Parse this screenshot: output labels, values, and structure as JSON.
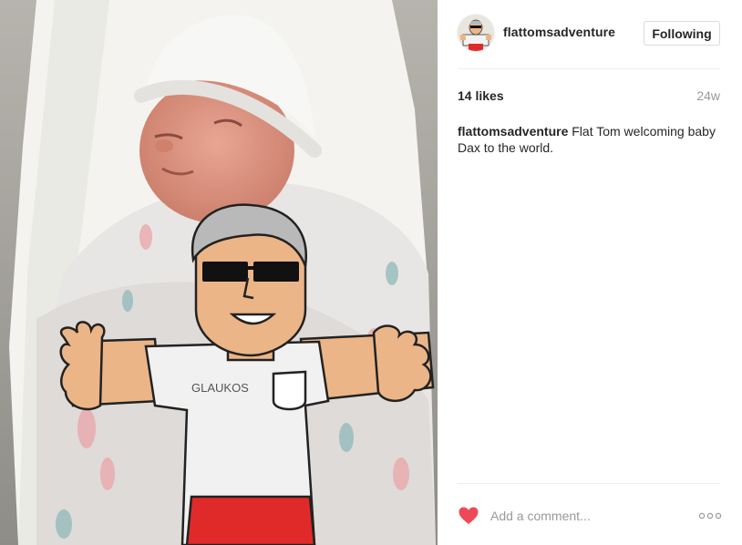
{
  "post": {
    "username": "flattomsadventure",
    "follow_label": "Following",
    "likes": "14 likes",
    "time_ago": "24w",
    "caption_user": "flattomsadventure",
    "caption_text": " Flat Tom welcoming baby Dax to the world.",
    "photo_shirt_logo": "GLAUKOS"
  },
  "comment": {
    "placeholder": "Add a comment..."
  },
  "icons": {
    "like": "heart-icon",
    "more": "more-options-icon",
    "avatar": "profile-avatar"
  },
  "colors": {
    "heart": "#ed4956",
    "secondary_text": "#999999",
    "border": "#dbdbdb"
  }
}
